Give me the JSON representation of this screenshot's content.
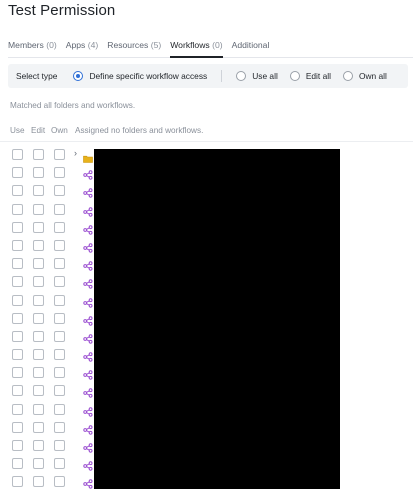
{
  "page": {
    "title": "Test Permission"
  },
  "tabs": [
    {
      "label": "Members",
      "count": "(0)"
    },
    {
      "label": "Apps",
      "count": "(4)"
    },
    {
      "label": "Resources",
      "count": "(5)"
    },
    {
      "label": "Workflows",
      "count": "(0)",
      "active": true
    },
    {
      "label": "Additional",
      "count": ""
    }
  ],
  "select_type": {
    "label": "Select type",
    "options": [
      {
        "label": "Define specific workflow access",
        "checked": true
      },
      {
        "label": "Use all",
        "checked": false
      },
      {
        "label": "Edit all",
        "checked": false
      },
      {
        "label": "Own all",
        "checked": false
      }
    ]
  },
  "matched_text": "Matched all folders and workflows.",
  "columns": {
    "use": "Use",
    "edit": "Edit",
    "own": "Own",
    "assigned_text": "Assigned no folders and workflows."
  },
  "colors": {
    "accent": "#2f6fd6",
    "folder": "#e8b21a",
    "workflow": "#9b4fd1",
    "redaction": "#000000"
  },
  "rows": [
    {
      "type": "folder",
      "icon": "folder-icon",
      "expandable": true
    },
    {
      "type": "workflow",
      "icon": "workflow-icon"
    },
    {
      "type": "workflow",
      "icon": "workflow-icon"
    },
    {
      "type": "workflow",
      "icon": "workflow-icon"
    },
    {
      "type": "workflow",
      "icon": "workflow-icon"
    },
    {
      "type": "workflow",
      "icon": "workflow-icon"
    },
    {
      "type": "workflow",
      "icon": "workflow-icon"
    },
    {
      "type": "workflow",
      "icon": "workflow-icon"
    },
    {
      "type": "workflow",
      "icon": "workflow-icon"
    },
    {
      "type": "workflow",
      "icon": "workflow-icon"
    },
    {
      "type": "workflow",
      "icon": "workflow-icon"
    },
    {
      "type": "workflow",
      "icon": "workflow-icon"
    },
    {
      "type": "workflow",
      "icon": "workflow-icon"
    },
    {
      "type": "workflow",
      "icon": "workflow-icon"
    },
    {
      "type": "workflow",
      "icon": "workflow-icon"
    },
    {
      "type": "workflow",
      "icon": "workflow-icon"
    },
    {
      "type": "workflow",
      "icon": "workflow-icon"
    },
    {
      "type": "workflow",
      "icon": "workflow-icon"
    },
    {
      "type": "workflow",
      "icon": "workflow-icon"
    }
  ]
}
